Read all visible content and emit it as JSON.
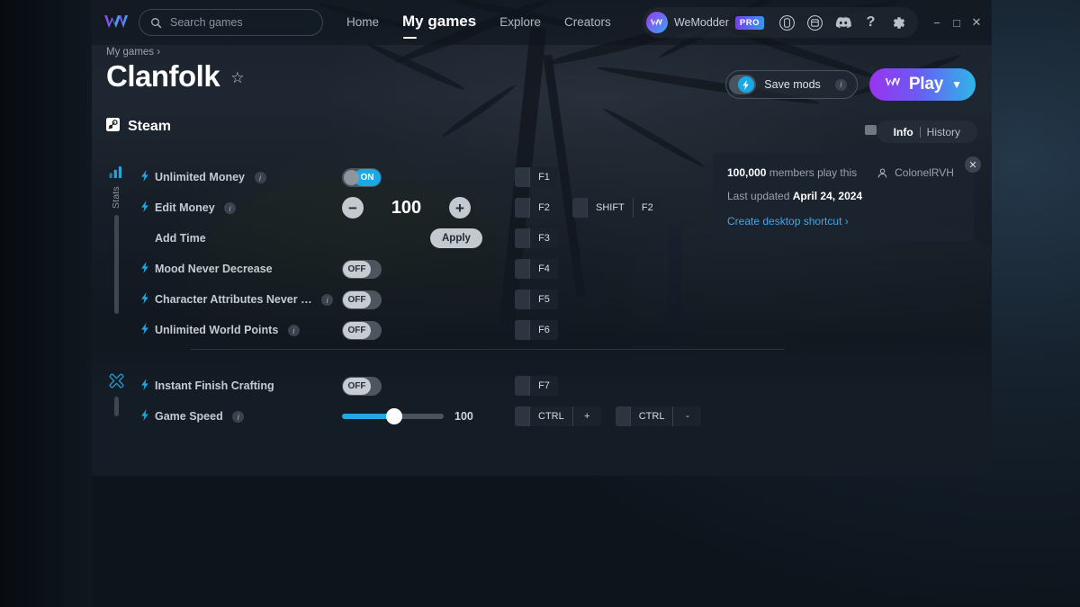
{
  "app": {
    "window_title": "WeMod"
  },
  "topnav": {
    "logo_icon": "wemod-logo-icon",
    "search": {
      "icon": "search-icon",
      "placeholder": "Search games",
      "value": ""
    },
    "links": [
      {
        "label": "Home",
        "active": false
      },
      {
        "label": "My games",
        "active": true
      },
      {
        "label": "Explore",
        "active": false
      },
      {
        "label": "Creators",
        "active": false
      }
    ],
    "user": {
      "name": "WeModder",
      "badge": "PRO",
      "avatar_icon": "wemod-avatar-icon"
    },
    "icons": [
      {
        "name": "phone-icon",
        "glyph": "phone"
      },
      {
        "name": "notes-icon",
        "glyph": "notes"
      },
      {
        "name": "discord-icon",
        "glyph": "discord"
      },
      {
        "name": "help-icon",
        "glyph": "?"
      },
      {
        "name": "gear-icon",
        "glyph": "gear"
      }
    ],
    "window_controls": {
      "minimize": "−",
      "maximize": "□",
      "close": "✕"
    }
  },
  "breadcrumb": "My games ›",
  "game": {
    "title": "Clanfolk",
    "favorite_icon": "star-icon",
    "platform": "Steam",
    "platform_icon": "steam-icon"
  },
  "actions": {
    "save_mods": {
      "label": "Save mods",
      "state": "on",
      "info": "i",
      "icon": "bolt-icon"
    },
    "play": {
      "label": "Play",
      "icon": "wemod-logo-icon",
      "chevron": "⌄"
    }
  },
  "tabs": {
    "note_icon": "note-icon",
    "items": [
      {
        "label": "Info",
        "active": true
      },
      {
        "label": "History",
        "active": false
      }
    ]
  },
  "info_card": {
    "members_count": "100,000",
    "members_text": "members play this",
    "author_icon": "person-icon",
    "author": "ColonelRVH",
    "updated_label": "Last updated",
    "updated_date": "April 24, 2024",
    "shortcut_link": "Create desktop shortcut ›",
    "close_icon": "close-icon"
  },
  "groups": [
    {
      "name": "Stats",
      "icon": "bar-chart-icon",
      "rail_height": 110,
      "rows": [
        {
          "label": "Unlimited Money",
          "bolt": true,
          "info": "i",
          "control": {
            "type": "toggle",
            "state": "on",
            "on_label": "ON"
          },
          "hotkeys": [
            {
              "keys": [
                "F1"
              ]
            }
          ]
        },
        {
          "label": "Edit Money",
          "bolt": true,
          "info": "i",
          "control": {
            "type": "stepper",
            "minus": "−",
            "plus": "+",
            "value": "100"
          },
          "hotkeys": [
            {
              "keys": [
                "F2"
              ]
            },
            {
              "keys": [
                "SHIFT",
                "F2"
              ]
            }
          ]
        },
        {
          "label": "Add Time",
          "bolt": false,
          "control": {
            "type": "button",
            "label": "Apply"
          },
          "hotkeys": [
            {
              "keys": [
                "F3"
              ]
            }
          ]
        },
        {
          "label": "Mood Never Decrease",
          "bolt": true,
          "control": {
            "type": "toggle",
            "state": "off",
            "off_label": "OFF"
          },
          "hotkeys": [
            {
              "keys": [
                "F4"
              ]
            }
          ]
        },
        {
          "label": "Character Attributes Never …",
          "bolt": true,
          "info": "i",
          "control": {
            "type": "toggle",
            "state": "off",
            "off_label": "OFF"
          },
          "hotkeys": [
            {
              "keys": [
                "F5"
              ]
            }
          ]
        },
        {
          "label": "Unlimited World Points",
          "bolt": true,
          "info": "i",
          "control": {
            "type": "toggle",
            "state": "off",
            "off_label": "OFF"
          },
          "hotkeys": [
            {
              "keys": [
                "F6"
              ]
            }
          ]
        }
      ]
    },
    {
      "name": "",
      "icon": "cross-icon",
      "rail_height": 22,
      "rows": [
        {
          "label": "Instant Finish Crafting",
          "bolt": true,
          "control": {
            "type": "toggle",
            "state": "off",
            "off_label": "OFF"
          },
          "hotkeys": [
            {
              "keys": [
                "F7"
              ]
            }
          ]
        },
        {
          "label": "Game Speed",
          "bolt": true,
          "info": "i",
          "control": {
            "type": "slider",
            "value": "100",
            "percent": 48
          },
          "hotkeys": [
            {
              "keys": [
                "CTRL",
                "+"
              ]
            },
            {
              "keys": [
                "CTRL",
                "-"
              ]
            }
          ]
        }
      ]
    }
  ],
  "colors": {
    "accent_cyan": "#17a9e8",
    "accent_purple": "#9a34ef",
    "panel_bg": "#141c26",
    "desktop_bg": "#0e1620",
    "link": "#3ea7e8"
  }
}
